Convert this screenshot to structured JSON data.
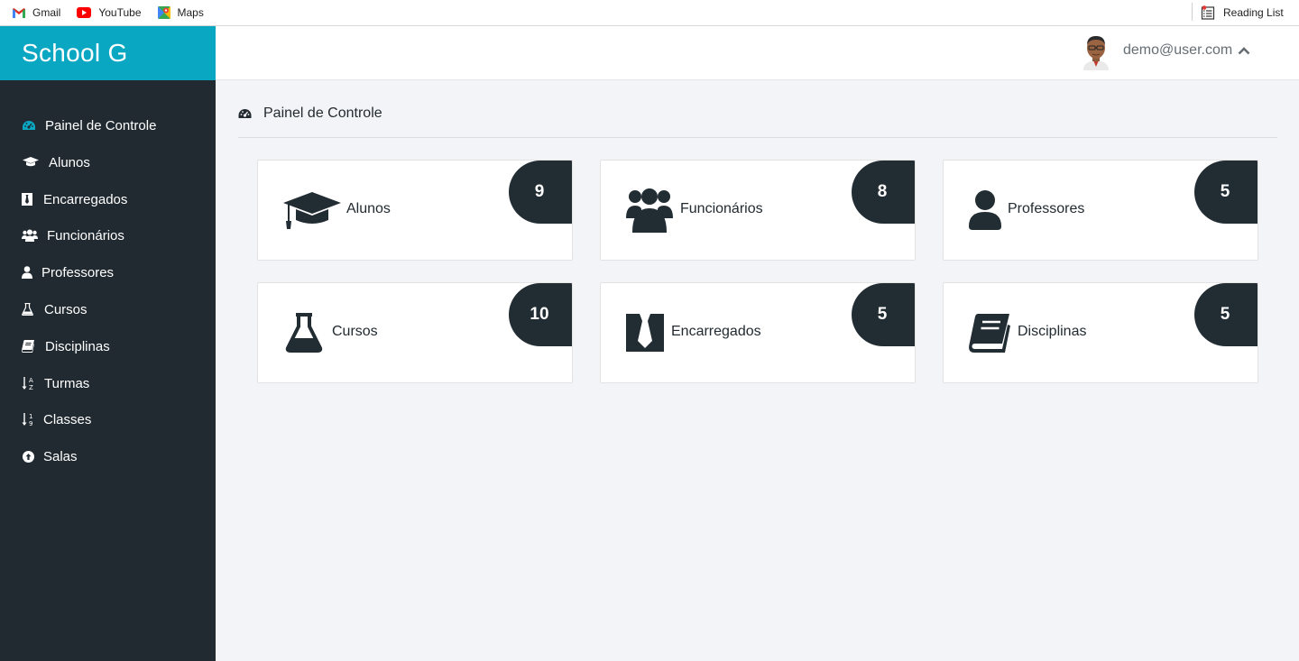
{
  "bookmarks": {
    "items": [
      {
        "label": "Gmail",
        "icon": "gmail-icon"
      },
      {
        "label": "YouTube",
        "icon": "youtube-icon"
      },
      {
        "label": "Maps",
        "icon": "maps-icon"
      }
    ],
    "reading_list": "Reading List"
  },
  "brand": {
    "title": "School G",
    "color": "#0aa7c2"
  },
  "sidebar": {
    "items": [
      {
        "label": "Painel de Controle",
        "icon": "dashboard-icon",
        "active": true
      },
      {
        "label": "Alunos",
        "icon": "graduation-cap-icon"
      },
      {
        "label": "Encarregados",
        "icon": "tie-icon"
      },
      {
        "label": "Funcionários",
        "icon": "users-icon"
      },
      {
        "label": "Professores",
        "icon": "user-icon"
      },
      {
        "label": "Cursos",
        "icon": "flask-icon"
      },
      {
        "label": "Disciplinas",
        "icon": "book-icon"
      },
      {
        "label": "Turmas",
        "icon": "sort-alpha-icon"
      },
      {
        "label": "Classes",
        "icon": "sort-numeric-icon"
      },
      {
        "label": "Salas",
        "icon": "arrow-circle-up-icon"
      }
    ]
  },
  "header": {
    "user_email": "demo@user.com"
  },
  "main": {
    "page_title": "Painel de Controle",
    "cards": [
      {
        "label": "Alunos",
        "count": "9",
        "icon": "graduation-cap-icon"
      },
      {
        "label": "Funcionários",
        "count": "8",
        "icon": "users-icon"
      },
      {
        "label": "Professores",
        "count": "5",
        "icon": "user-icon"
      },
      {
        "label": "Cursos",
        "count": "10",
        "icon": "flask-icon"
      },
      {
        "label": "Encarregados",
        "count": "5",
        "icon": "tie-icon"
      },
      {
        "label": "Disciplinas",
        "count": "5",
        "icon": "book-icon"
      }
    ]
  },
  "colors": {
    "sidebar": "#212a31",
    "badge": "#222c33",
    "background": "#f3f4f7"
  }
}
